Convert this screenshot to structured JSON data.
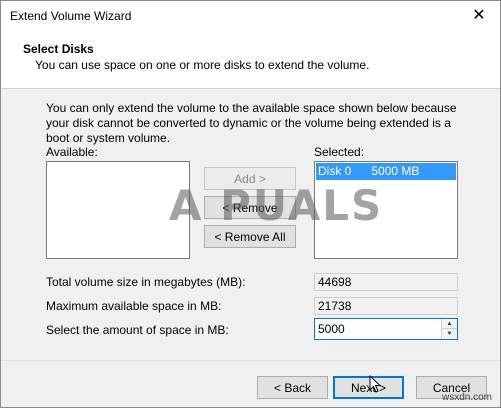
{
  "window": {
    "title": "Extend Volume Wizard",
    "close_glyph": "✕"
  },
  "header": {
    "title": "Select Disks",
    "subtitle": "You can use space on one or more disks to extend the volume."
  },
  "body": {
    "description": "You can only extend the volume to the available space shown below because your disk cannot be converted to dynamic or the volume being extended is a boot or system volume.",
    "available_label": "Available:",
    "selected_label": "Selected:",
    "selected_items": [
      {
        "disk": "Disk 0",
        "size": "5000 MB"
      }
    ],
    "add_label": "Add >",
    "remove_label": "< Remove",
    "remove_all_label": "< Remove All",
    "total_label": "Total volume size in megabytes (MB):",
    "total_value": "44698",
    "max_label": "Maximum available space in MB:",
    "max_value": "21738",
    "amount_label": "Select the amount of space in MB:",
    "amount_value": "5000"
  },
  "footer": {
    "back_label": "< Back",
    "next_label": "Next >",
    "cancel_label": "Cancel"
  },
  "watermark": {
    "text": "A PUALS",
    "site": "wsxdn.com"
  }
}
